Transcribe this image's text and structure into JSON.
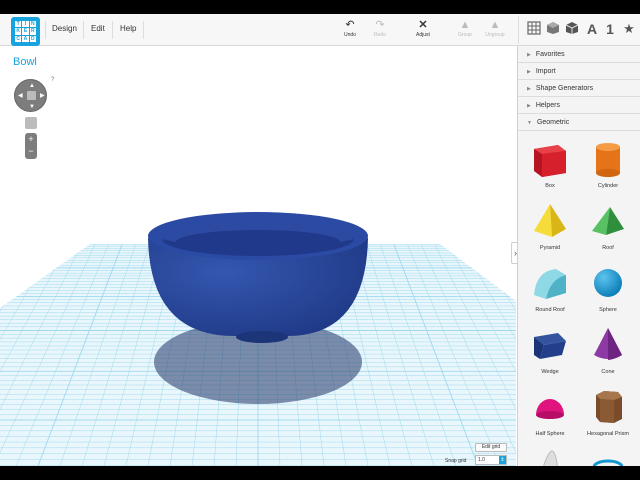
{
  "app": {
    "document_title": "Bowl",
    "logo_letters": [
      "T",
      "I",
      "N",
      "K",
      "E",
      "R",
      "C",
      "A",
      "D"
    ]
  },
  "menu": [
    {
      "id": "design",
      "label": "Design"
    },
    {
      "id": "edit",
      "label": "Edit"
    },
    {
      "id": "help",
      "label": "Help"
    }
  ],
  "tools": {
    "undo": {
      "label": "Undo",
      "icon": "undo-icon",
      "enabled": true
    },
    "redo": {
      "label": "Redo",
      "icon": "redo-icon",
      "enabled": false
    },
    "adjust": {
      "label": "Adjust",
      "icon": "adjust-icon",
      "enabled": true
    },
    "group": {
      "label": "Group",
      "icon": "group-icon",
      "enabled": false
    },
    "ungroup": {
      "label": "Ungroup",
      "icon": "ungroup-icon",
      "enabled": false
    }
  },
  "view_icons": [
    "grid-view-icon",
    "box-view-icon",
    "cube-view-icon",
    "text-A-icon",
    "number-1-icon",
    "star-icon"
  ],
  "view_icon_text": {
    "text": "A",
    "number": "1",
    "star": "★"
  },
  "canvas": {
    "help_mark": "?",
    "edit_grid_label": "Edit grid",
    "snap_grid_label": "Snap grid",
    "snap_grid_value": "1.0",
    "bowl_color": "#27469b",
    "grid_color": "#9fd9ee"
  },
  "sections": [
    {
      "id": "favorites",
      "label": "Favorites",
      "expanded": false
    },
    {
      "id": "import",
      "label": "Import",
      "expanded": false
    },
    {
      "id": "shape-generators",
      "label": "Shape Generators",
      "expanded": false
    },
    {
      "id": "helpers",
      "label": "Helpers",
      "expanded": false
    },
    {
      "id": "geometric",
      "label": "Geometric",
      "expanded": true
    }
  ],
  "shapes": [
    {
      "id": "box",
      "label": "Box",
      "color": "#d6202b"
    },
    {
      "id": "cylinder",
      "label": "Cylinder",
      "color": "#ef7d1a"
    },
    {
      "id": "pyramid",
      "label": "Pyramid",
      "color": "#f3cf1d"
    },
    {
      "id": "roof",
      "label": "Roof",
      "color": "#3aa94a"
    },
    {
      "id": "round-roof",
      "label": "Round Roof",
      "color": "#6fc7d9"
    },
    {
      "id": "sphere",
      "label": "Sphere",
      "color": "#1597cf"
    },
    {
      "id": "wedge",
      "label": "Wedge",
      "color": "#213f8f"
    },
    {
      "id": "cone",
      "label": "Cone",
      "color": "#8e3aa5"
    },
    {
      "id": "half-sphere",
      "label": "Half Sphere",
      "color": "#e0147f"
    },
    {
      "id": "hexagonal-prism",
      "label": "Hexagonal Prism",
      "color": "#8a5a35"
    }
  ]
}
